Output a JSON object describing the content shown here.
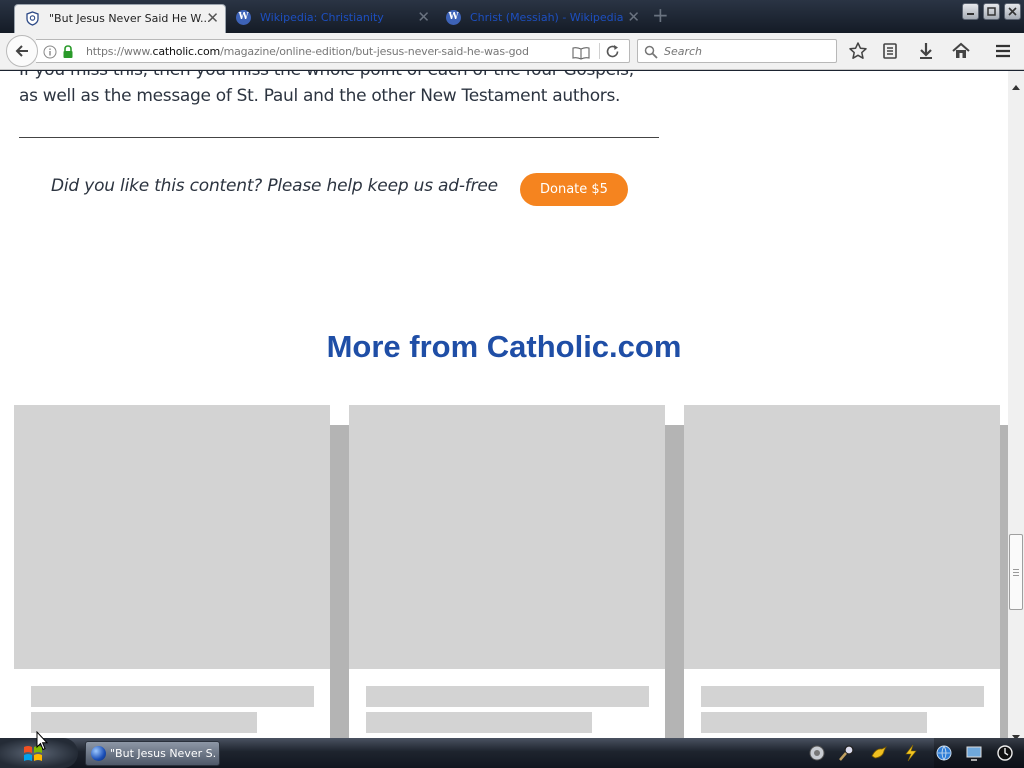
{
  "browser": {
    "tabs": [
      {
        "title": "\"But Jesus Never Said He W...",
        "active": true,
        "icon": "catholic-shield-icon"
      },
      {
        "title": "Wikipedia: Christianity",
        "active": false,
        "icon": "wikipedia-w-icon"
      },
      {
        "title": "Christ (Messiah) - Wikipedia",
        "active": false,
        "icon": "wikipedia-w-icon"
      }
    ],
    "url": {
      "prefix": "https://www.",
      "domain": "catholic.com",
      "path": "/magazine/online-edition/but-jesus-never-said-he-was-god"
    },
    "search_placeholder": "Search"
  },
  "page": {
    "article_lines": [
      "If you miss this, then you miss the whole point of each of the four Gospels,",
      "as well as the message of St. Paul and the other New Testament authors."
    ],
    "donate_prompt": "Did you like this content? Please help keep us ad-free",
    "donate_button": "Donate $5",
    "more_heading": "More from Catholic.com",
    "cards_count": 3
  },
  "taskbar": {
    "task_label": "\"But Jesus Never S..."
  },
  "colors": {
    "accent_orange": "#f5841f",
    "heading_blue": "#1f4ea6",
    "placeholder_gray": "#d3d3d3"
  }
}
